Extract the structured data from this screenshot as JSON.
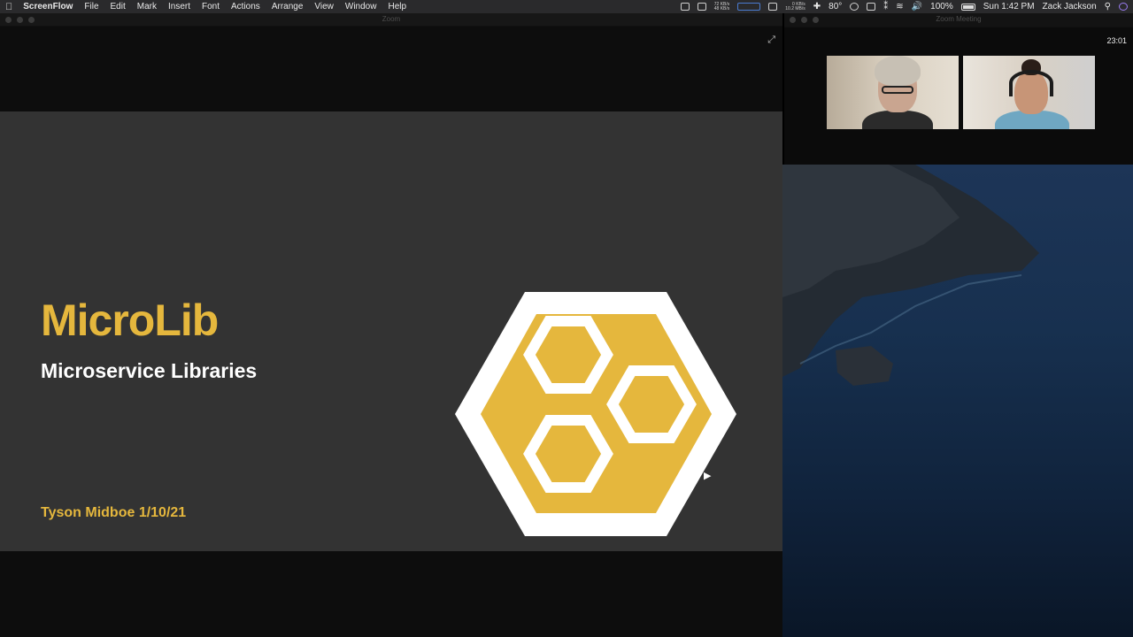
{
  "menubar": {
    "app_name": "ScreenFlow",
    "menus": [
      "File",
      "Edit",
      "Mark",
      "Insert",
      "Font",
      "Actions",
      "Arrange",
      "View",
      "Window",
      "Help"
    ],
    "net_up": "72 KB/s",
    "net_down": "48 KB/s",
    "disk_read": "0 KB/s",
    "disk_write": "10.2 MB/s",
    "temperature": "80°",
    "battery": "100%",
    "clock": "Sun 1:42 PM",
    "user": "Zack Jackson"
  },
  "zoom_window": {
    "title": "Zoom",
    "slide": {
      "title": "MicroLib",
      "subtitle": "Microservice Libraries",
      "author": "Tyson Midboe 1/10/21"
    }
  },
  "meeting_window": {
    "title": "Zoom Meeting",
    "timer": "23:01"
  },
  "colors": {
    "brand": "#e5b73d",
    "slide_bg": "#333333"
  },
  "icons": [
    "apple-icon",
    "fullscreen-icon",
    "wifi-icon",
    "volume-icon",
    "battery-icon",
    "search-icon",
    "siri-icon"
  ]
}
